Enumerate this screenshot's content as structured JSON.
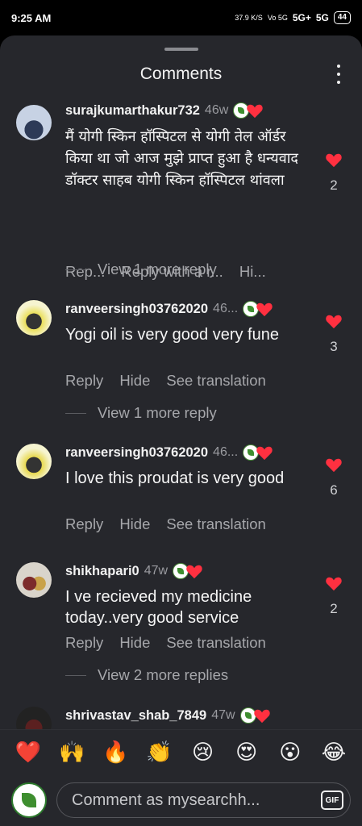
{
  "status_bar": {
    "time": "9:25 AM",
    "speed": "37.9 K/S",
    "volte": "Vo 5G",
    "net1": "5G+",
    "net2": "5G",
    "battery": "44"
  },
  "sheet": {
    "title": "Comments"
  },
  "comments": [
    {
      "username": "surajkumarthakur732",
      "age": "46w",
      "text": "मैं योगी स्किन हॉस्पिटल से योगी तेल ऑर्डर किया था जो आज मुझे प्राप्त हुआ है धन्यवाद डॉक्टर साहब योगी स्किन हॉस्पिटल थांवला",
      "actions": [
        "Rep...",
        "Reply with a r...",
        "Hi..."
      ],
      "likes": "2",
      "view_replies": "View 1 more reply"
    },
    {
      "username": "ranveersingh03762020",
      "age": "46...",
      "text": "Yogi oil is very good very fune",
      "actions": [
        "Reply",
        "Hide",
        "See translation"
      ],
      "likes": "3",
      "view_replies": "View 1 more reply"
    },
    {
      "username": "ranveersingh03762020",
      "age": "46...",
      "text": "I love this proudat is very good",
      "actions": [
        "Reply",
        "Hide",
        "See translation"
      ],
      "likes": "6",
      "view_replies": ""
    },
    {
      "username": "shikhapari0",
      "age": "47w",
      "text": "I ve recieved my medicine today..very good service",
      "actions": [
        "Reply",
        "Hide",
        "See translation"
      ],
      "likes": "2",
      "view_replies": "View 2 more replies"
    },
    {
      "username": "shrivastav_shab_7849",
      "age": "47w",
      "text": "",
      "actions": [],
      "likes": "",
      "view_replies": ""
    }
  ],
  "reactions": [
    "❤️",
    "🙌",
    "🔥",
    "👏",
    "😢",
    "😍",
    "😮",
    "😂"
  ],
  "input": {
    "placeholder": "Comment as mysearchh...",
    "gif_label": "GIF"
  },
  "colors": {
    "background": "#26272c",
    "heart": "#ff3040",
    "muted_text": "#a6a7ab"
  }
}
